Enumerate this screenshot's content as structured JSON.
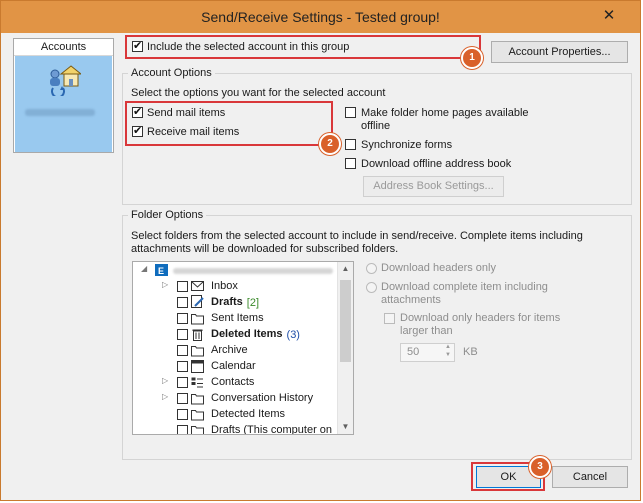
{
  "window": {
    "title": "Send/Receive Settings - Tested group!"
  },
  "accounts": {
    "header": "Accounts",
    "selected_account_label": "",
    "icon": "account-group-icon"
  },
  "top": {
    "include_account_label": "Include the selected account in this group",
    "include_account_checked": true,
    "account_properties_label": "Account Properties..."
  },
  "account_options": {
    "legend": "Account Options",
    "prompt": "Select the options you want for the selected account",
    "send_mail_label": "Send mail items",
    "send_mail_checked": true,
    "receive_mail_label": "Receive mail items",
    "receive_mail_checked": true,
    "make_folder_home_label_1": "Make folder home pages available",
    "make_folder_home_label_2": "offline",
    "synchronize_forms_label": "Synchronize forms",
    "download_oab_label": "Download offline address book",
    "address_book_settings_label": "Address Book Settings..."
  },
  "folder_options": {
    "legend": "Folder Options",
    "description_1": "Select folders from the selected account to include in send/receive. Complete items including",
    "description_2": "attachments will be downloaded for subscribed folders.",
    "tree": {
      "root_label": "",
      "items": [
        {
          "label": "Inbox",
          "count": "",
          "bold": false,
          "icon": "inbox-icon",
          "expandable": true
        },
        {
          "label": "Drafts",
          "count": "[2]",
          "bold": true,
          "icon": "drafts-icon",
          "expandable": false
        },
        {
          "label": "Sent Items",
          "count": "",
          "bold": false,
          "icon": "folder-icon",
          "expandable": false
        },
        {
          "label": "Deleted Items",
          "count": "(3)",
          "bold": true,
          "icon": "trash-icon",
          "expandable": false
        },
        {
          "label": "Archive",
          "count": "",
          "bold": false,
          "icon": "folder-icon",
          "expandable": false
        },
        {
          "label": "Calendar",
          "count": "",
          "bold": false,
          "icon": "calendar-icon",
          "expandable": false
        },
        {
          "label": "Contacts",
          "count": "",
          "bold": false,
          "icon": "contacts-icon",
          "expandable": true
        },
        {
          "label": "Conversation History",
          "count": "",
          "bold": false,
          "icon": "folder-icon",
          "expandable": true
        },
        {
          "label": "Detected Items",
          "count": "",
          "bold": false,
          "icon": "folder-icon",
          "expandable": false
        },
        {
          "label": "Drafts (This computer on",
          "count": "",
          "bold": false,
          "icon": "folder-icon",
          "expandable": false
        }
      ]
    },
    "download_headers_only_label": "Download headers only",
    "download_complete_label_1": "Download complete item including",
    "download_complete_label_2": "attachments",
    "download_only_headers_label_1": "Download only headers for items",
    "download_only_headers_label_2": "larger than",
    "size_value": "50",
    "size_unit": "KB"
  },
  "footer": {
    "ok_label": "OK",
    "cancel_label": "Cancel"
  },
  "callouts": {
    "badge_1": "1",
    "badge_2": "2",
    "badge_3": "3"
  },
  "colors": {
    "titlebar": "#e19445",
    "accent_red": "#d9373a",
    "badge": "#d9602a",
    "selection": "#99c9ef"
  }
}
